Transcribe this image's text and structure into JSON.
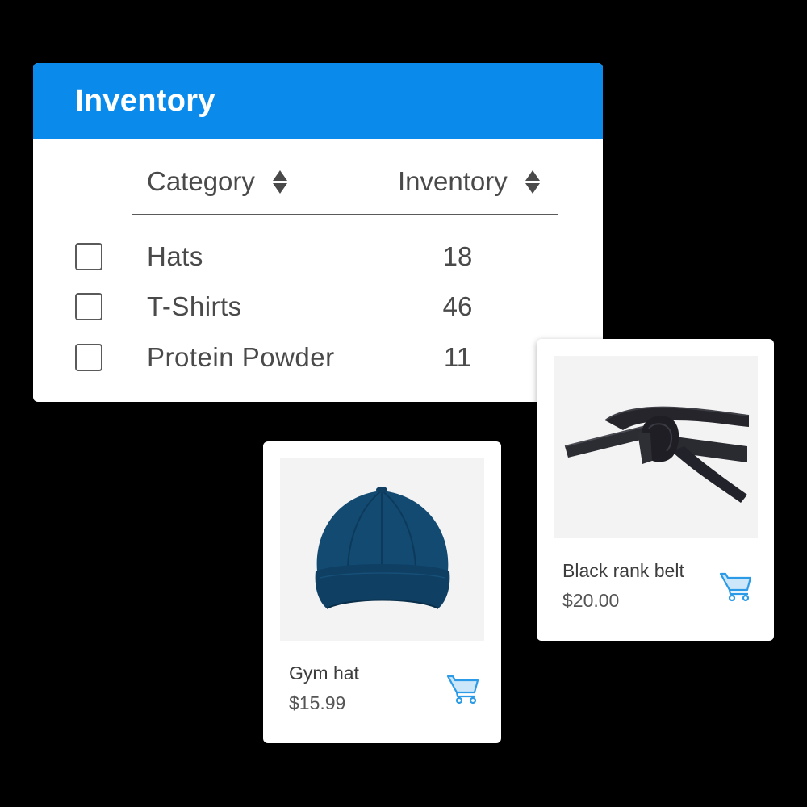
{
  "inventory_panel": {
    "title": "Inventory",
    "header_color": "#0a8bec",
    "columns": [
      {
        "label": "Category",
        "sort_icon": "sort-icon"
      },
      {
        "label": "Inventory",
        "sort_icon": "sort-icon"
      }
    ],
    "rows": [
      {
        "category": "Hats",
        "inventory": "18",
        "checked": false
      },
      {
        "category": "T-Shirts",
        "inventory": "46",
        "checked": false
      },
      {
        "category": "Protein Powder",
        "inventory": "11",
        "checked": false
      }
    ]
  },
  "products": [
    {
      "name": "Black rank belt",
      "price": "$20.00",
      "image": "black-belt-image",
      "action_icon": "shopping-cart-icon"
    },
    {
      "name": "Gym hat",
      "price": "$15.99",
      "image": "navy-cap-image",
      "action_icon": "shopping-cart-icon"
    }
  ],
  "colors": {
    "accent": "#0a8bec",
    "cart_icon": "#2b9be8",
    "cart_fill": "#cde7fa"
  }
}
